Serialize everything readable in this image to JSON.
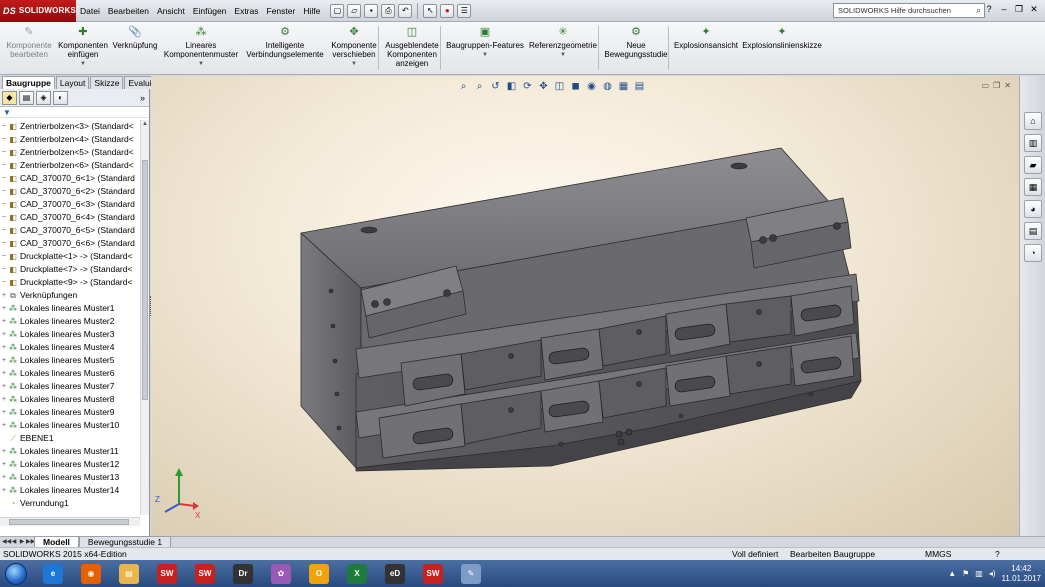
{
  "app": {
    "logo_text": "SOLIDWORKS",
    "menu": [
      "Datei",
      "Bearbeiten",
      "Ansicht",
      "Einfügen",
      "Extras",
      "Fenster",
      "Hilfe"
    ],
    "search_placeholder": "SOLIDWORKS Hilfe durchsuchen"
  },
  "commands": [
    {
      "label": "Komponente bearbeiten",
      "icon": "edit-component-icon",
      "glyph": "✎",
      "disabled": true
    },
    {
      "label": "Komponenten einfügen",
      "icon": "insert-components-icon",
      "glyph": "✚",
      "arrow": true
    },
    {
      "label": "Verknüpfung",
      "icon": "mate-icon",
      "glyph": "📎"
    },
    {
      "label": "Lineares Komponentenmuster",
      "icon": "linear-pattern-icon",
      "glyph": "⁂",
      "arrow": true
    },
    {
      "label": "Intelligente Verbindungselemente",
      "icon": "smart-fasteners-icon",
      "glyph": "⚙"
    },
    {
      "label": "Komponente verschieben",
      "icon": "move-component-icon",
      "glyph": "✥",
      "arrow": true
    },
    {
      "label": "Ausgeblendete Komponenten anzeigen",
      "icon": "show-hidden-icon",
      "glyph": "◫"
    },
    {
      "label": "Baugruppen-Features",
      "icon": "assembly-features-icon",
      "glyph": "▣",
      "arrow": true
    },
    {
      "label": "Referenzgeometrie",
      "icon": "reference-geometry-icon",
      "glyph": "✳",
      "arrow": true
    },
    {
      "label": "Neue Bewegungsstudie",
      "icon": "motion-study-icon",
      "glyph": "⚙"
    },
    {
      "label": "Explosionsansicht",
      "icon": "exploded-view-icon",
      "glyph": "✦"
    },
    {
      "label": "Explosionslinienskizze",
      "icon": "explode-line-sketch-icon",
      "glyph": "✦"
    }
  ],
  "tabs": [
    {
      "label": "Baugruppe",
      "active": true
    },
    {
      "label": "Layout"
    },
    {
      "label": "Skizze"
    },
    {
      "label": "Evaluieren"
    }
  ],
  "tree": [
    {
      "label": "Zentrierbolzen<3> (Standard<",
      "icon": "part",
      "exp": "−"
    },
    {
      "label": "Zentrierbolzen<4> (Standard<",
      "icon": "part",
      "exp": "−"
    },
    {
      "label": "Zentrierbolzen<5> (Standard<",
      "icon": "part",
      "exp": "−"
    },
    {
      "label": "Zentrierbolzen<6> (Standard<",
      "icon": "part",
      "exp": "−"
    },
    {
      "label": "CAD_370070_6<1> (Standard",
      "icon": "part",
      "exp": "−"
    },
    {
      "label": "CAD_370070_6<2> (Standard",
      "icon": "part",
      "exp": "−"
    },
    {
      "label": "CAD_370070_6<3> (Standard",
      "icon": "part",
      "exp": "−"
    },
    {
      "label": "CAD_370070_6<4> (Standard",
      "icon": "part",
      "exp": "−"
    },
    {
      "label": "CAD_370070_6<5> (Standard",
      "icon": "part",
      "exp": "−"
    },
    {
      "label": "CAD_370070_6<6> (Standard",
      "icon": "part",
      "exp": "−"
    },
    {
      "label": "Druckplatte<1> -> (Standard<",
      "icon": "part",
      "exp": "−"
    },
    {
      "label": "Druckplatte<7> -> (Standard<",
      "icon": "part",
      "exp": "−"
    },
    {
      "label": "Druckplatte<9> -> (Standard<",
      "icon": "part",
      "exp": "−"
    },
    {
      "label": "Verknüpfungen",
      "icon": "mates",
      "exp": "+"
    },
    {
      "label": "Lokales lineares Muster1",
      "icon": "pattern",
      "exp": "+"
    },
    {
      "label": "Lokales lineares Muster2",
      "icon": "pattern",
      "exp": "+"
    },
    {
      "label": "Lokales lineares Muster3",
      "icon": "pattern",
      "exp": "+"
    },
    {
      "label": "Lokales lineares Muster4",
      "icon": "pattern",
      "exp": "+"
    },
    {
      "label": "Lokales lineares Muster5",
      "icon": "pattern",
      "exp": "+"
    },
    {
      "label": "Lokales lineares Muster6",
      "icon": "pattern",
      "exp": "+"
    },
    {
      "label": "Lokales lineares Muster7",
      "icon": "pattern",
      "exp": "+"
    },
    {
      "label": "Lokales lineares Muster8",
      "icon": "pattern",
      "exp": "+"
    },
    {
      "label": "Lokales lineares Muster9",
      "icon": "pattern",
      "exp": "+"
    },
    {
      "label": "Lokales lineares Muster10",
      "icon": "pattern",
      "exp": "+"
    },
    {
      "label": "EBENE1",
      "icon": "plane",
      "exp": ""
    },
    {
      "label": "Lokales lineares Muster11",
      "icon": "pattern",
      "exp": "+"
    },
    {
      "label": "Lokales lineares Muster12",
      "icon": "pattern",
      "exp": "+"
    },
    {
      "label": "Lokales lineares Muster13",
      "icon": "pattern",
      "exp": "+"
    },
    {
      "label": "Lokales lineares Muster14",
      "icon": "pattern",
      "exp": "+"
    },
    {
      "label": "Verrundung1",
      "icon": "fillet",
      "exp": ""
    }
  ],
  "bottom_tabs": [
    {
      "label": "Modell",
      "active": true
    },
    {
      "label": "Bewegungsstudie 1"
    }
  ],
  "status": {
    "edition": "SOLIDWORKS 2015 x64-Edition",
    "definition": "Voll definiert",
    "mode": "Bearbeiten Baugruppe",
    "units": "MMGS",
    "help": "?"
  },
  "taskbar": {
    "time": "14:42",
    "date": "11.01.2017",
    "apps": [
      {
        "icon": "internet-explorer-icon",
        "text": "e",
        "bg": "#1d77d6"
      },
      {
        "icon": "firefox-icon",
        "text": "◉",
        "bg": "#e66000"
      },
      {
        "icon": "file-explorer-icon",
        "text": "▤",
        "bg": "#e8b64a"
      },
      {
        "icon": "solidworks-2015-icon",
        "text": "SW",
        "bg": "#c8201f"
      },
      {
        "icon": "solidworks-2016-icon",
        "text": "SW",
        "bg": "#c8201f"
      },
      {
        "icon": "emachineshop-icon",
        "text": "Dr",
        "bg": "#333"
      },
      {
        "icon": "paint-icon",
        "text": "✿",
        "bg": "#9b59b6"
      },
      {
        "icon": "outlook-icon",
        "text": "O",
        "bg": "#f0a30a"
      },
      {
        "icon": "excel-icon",
        "text": "X",
        "bg": "#1f7a3d"
      },
      {
        "icon": "edrawings-icon",
        "text": "eD",
        "bg": "#333"
      },
      {
        "icon": "solidworks-2016b-icon",
        "text": "SW",
        "bg": "#c8201f"
      },
      {
        "icon": "sketch-tool-icon",
        "text": "✎",
        "bg": "#7d9cc8"
      }
    ]
  },
  "colors": {
    "accent": "#c41b1b",
    "model_face": "#77767a",
    "background": "#f3ead8"
  }
}
